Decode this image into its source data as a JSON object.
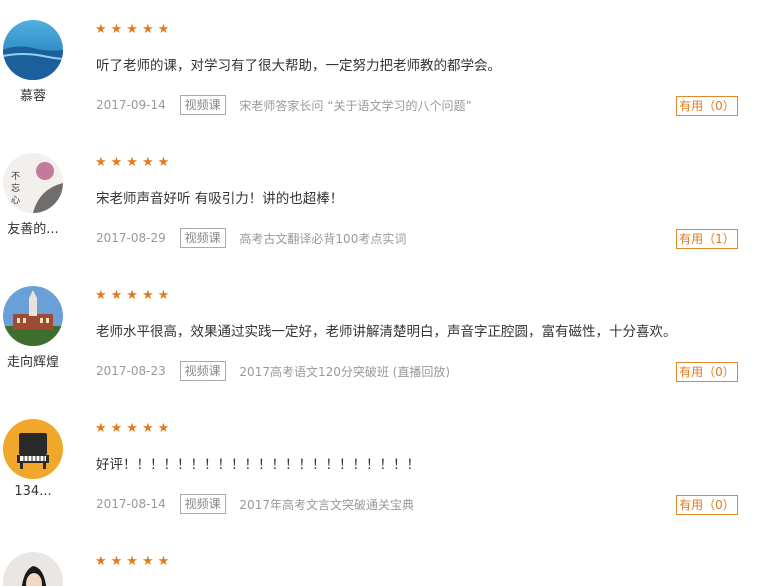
{
  "reviews": [
    {
      "username": "慕蓉",
      "stars": "★★★★★",
      "comment": "听了老师的课，对学习有了很大帮助，一定努力把老师教的都学会。",
      "date": "2017-09-14",
      "tag": "视频课",
      "course": "宋老师答家长问 “关于语文学习的八个问题”",
      "useful": "有用（0）"
    },
    {
      "username": "友善的...",
      "stars": "★★★★★",
      "comment": "宋老师声音好听 有吸引力！讲的也超棒！",
      "date": "2017-08-29",
      "tag": "视频课",
      "course": "高考古文翻译必背100考点实词",
      "useful": "有用（1）"
    },
    {
      "username": "走向辉煌",
      "stars": "★★★★★",
      "comment": "老师水平很高，效果通过实践一定好，老师讲解清楚明白，声音字正腔圆，富有磁性，十分喜欢。",
      "date": "2017-08-23",
      "tag": "视频课",
      "course": "2017高考语文120分突破班 (直播回放)",
      "useful": "有用（0）"
    },
    {
      "username": "134...",
      "stars": "★★★★★",
      "comment": "好评！！！！！！！！！！！！！！！！！！！！！！",
      "date": "2017-08-14",
      "tag": "视频课",
      "course": "2017年高考文言文突破通关宝典",
      "useful": "有用（0）"
    },
    {
      "username": "",
      "stars": "★★★★★",
      "comment": "",
      "date": "",
      "tag": "",
      "course": "",
      "useful": ""
    }
  ],
  "colors": {
    "accent": "#e07b1f",
    "meta_text": "#999999"
  }
}
